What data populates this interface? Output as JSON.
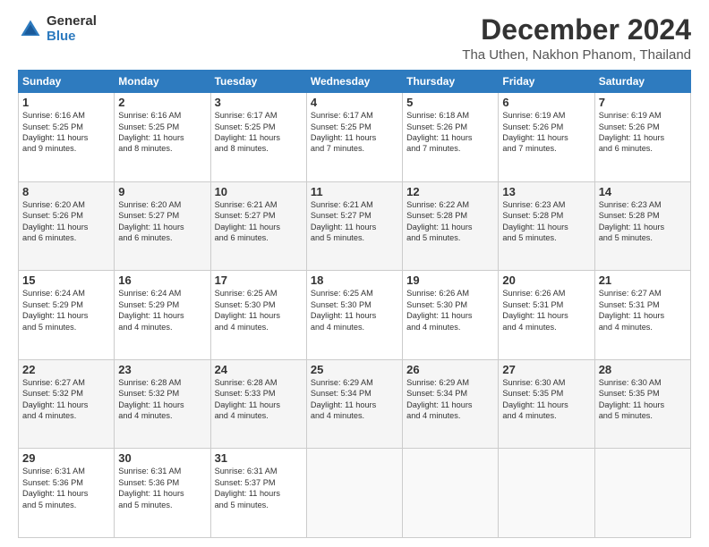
{
  "logo": {
    "general": "General",
    "blue": "Blue"
  },
  "title": "December 2024",
  "subtitle": "Tha Uthen, Nakhon Phanom, Thailand",
  "headers": [
    "Sunday",
    "Monday",
    "Tuesday",
    "Wednesday",
    "Thursday",
    "Friday",
    "Saturday"
  ],
  "weeks": [
    [
      {
        "day": "1",
        "sunrise": "6:16 AM",
        "sunset": "5:25 PM",
        "daylight": "11 hours and 9 minutes."
      },
      {
        "day": "2",
        "sunrise": "6:16 AM",
        "sunset": "5:25 PM",
        "daylight": "11 hours and 8 minutes."
      },
      {
        "day": "3",
        "sunrise": "6:17 AM",
        "sunset": "5:25 PM",
        "daylight": "11 hours and 8 minutes."
      },
      {
        "day": "4",
        "sunrise": "6:17 AM",
        "sunset": "5:25 PM",
        "daylight": "11 hours and 7 minutes."
      },
      {
        "day": "5",
        "sunrise": "6:18 AM",
        "sunset": "5:26 PM",
        "daylight": "11 hours and 7 minutes."
      },
      {
        "day": "6",
        "sunrise": "6:19 AM",
        "sunset": "5:26 PM",
        "daylight": "11 hours and 7 minutes."
      },
      {
        "day": "7",
        "sunrise": "6:19 AM",
        "sunset": "5:26 PM",
        "daylight": "11 hours and 6 minutes."
      }
    ],
    [
      {
        "day": "8",
        "sunrise": "6:20 AM",
        "sunset": "5:26 PM",
        "daylight": "11 hours and 6 minutes."
      },
      {
        "day": "9",
        "sunrise": "6:20 AM",
        "sunset": "5:27 PM",
        "daylight": "11 hours and 6 minutes."
      },
      {
        "day": "10",
        "sunrise": "6:21 AM",
        "sunset": "5:27 PM",
        "daylight": "11 hours and 6 minutes."
      },
      {
        "day": "11",
        "sunrise": "6:21 AM",
        "sunset": "5:27 PM",
        "daylight": "11 hours and 5 minutes."
      },
      {
        "day": "12",
        "sunrise": "6:22 AM",
        "sunset": "5:28 PM",
        "daylight": "11 hours and 5 minutes."
      },
      {
        "day": "13",
        "sunrise": "6:23 AM",
        "sunset": "5:28 PM",
        "daylight": "11 hours and 5 minutes."
      },
      {
        "day": "14",
        "sunrise": "6:23 AM",
        "sunset": "5:28 PM",
        "daylight": "11 hours and 5 minutes."
      }
    ],
    [
      {
        "day": "15",
        "sunrise": "6:24 AM",
        "sunset": "5:29 PM",
        "daylight": "11 hours and 5 minutes."
      },
      {
        "day": "16",
        "sunrise": "6:24 AM",
        "sunset": "5:29 PM",
        "daylight": "11 hours and 4 minutes."
      },
      {
        "day": "17",
        "sunrise": "6:25 AM",
        "sunset": "5:30 PM",
        "daylight": "11 hours and 4 minutes."
      },
      {
        "day": "18",
        "sunrise": "6:25 AM",
        "sunset": "5:30 PM",
        "daylight": "11 hours and 4 minutes."
      },
      {
        "day": "19",
        "sunrise": "6:26 AM",
        "sunset": "5:30 PM",
        "daylight": "11 hours and 4 minutes."
      },
      {
        "day": "20",
        "sunrise": "6:26 AM",
        "sunset": "5:31 PM",
        "daylight": "11 hours and 4 minutes."
      },
      {
        "day": "21",
        "sunrise": "6:27 AM",
        "sunset": "5:31 PM",
        "daylight": "11 hours and 4 minutes."
      }
    ],
    [
      {
        "day": "22",
        "sunrise": "6:27 AM",
        "sunset": "5:32 PM",
        "daylight": "11 hours and 4 minutes."
      },
      {
        "day": "23",
        "sunrise": "6:28 AM",
        "sunset": "5:32 PM",
        "daylight": "11 hours and 4 minutes."
      },
      {
        "day": "24",
        "sunrise": "6:28 AM",
        "sunset": "5:33 PM",
        "daylight": "11 hours and 4 minutes."
      },
      {
        "day": "25",
        "sunrise": "6:29 AM",
        "sunset": "5:34 PM",
        "daylight": "11 hours and 4 minutes."
      },
      {
        "day": "26",
        "sunrise": "6:29 AM",
        "sunset": "5:34 PM",
        "daylight": "11 hours and 4 minutes."
      },
      {
        "day": "27",
        "sunrise": "6:30 AM",
        "sunset": "5:35 PM",
        "daylight": "11 hours and 4 minutes."
      },
      {
        "day": "28",
        "sunrise": "6:30 AM",
        "sunset": "5:35 PM",
        "daylight": "11 hours and 5 minutes."
      }
    ],
    [
      {
        "day": "29",
        "sunrise": "6:31 AM",
        "sunset": "5:36 PM",
        "daylight": "11 hours and 5 minutes."
      },
      {
        "day": "30",
        "sunrise": "6:31 AM",
        "sunset": "5:36 PM",
        "daylight": "11 hours and 5 minutes."
      },
      {
        "day": "31",
        "sunrise": "6:31 AM",
        "sunset": "5:37 PM",
        "daylight": "11 hours and 5 minutes."
      },
      null,
      null,
      null,
      null
    ]
  ],
  "labels": {
    "sunrise": "Sunrise:",
    "sunset": "Sunset:",
    "daylight": "Daylight:"
  }
}
